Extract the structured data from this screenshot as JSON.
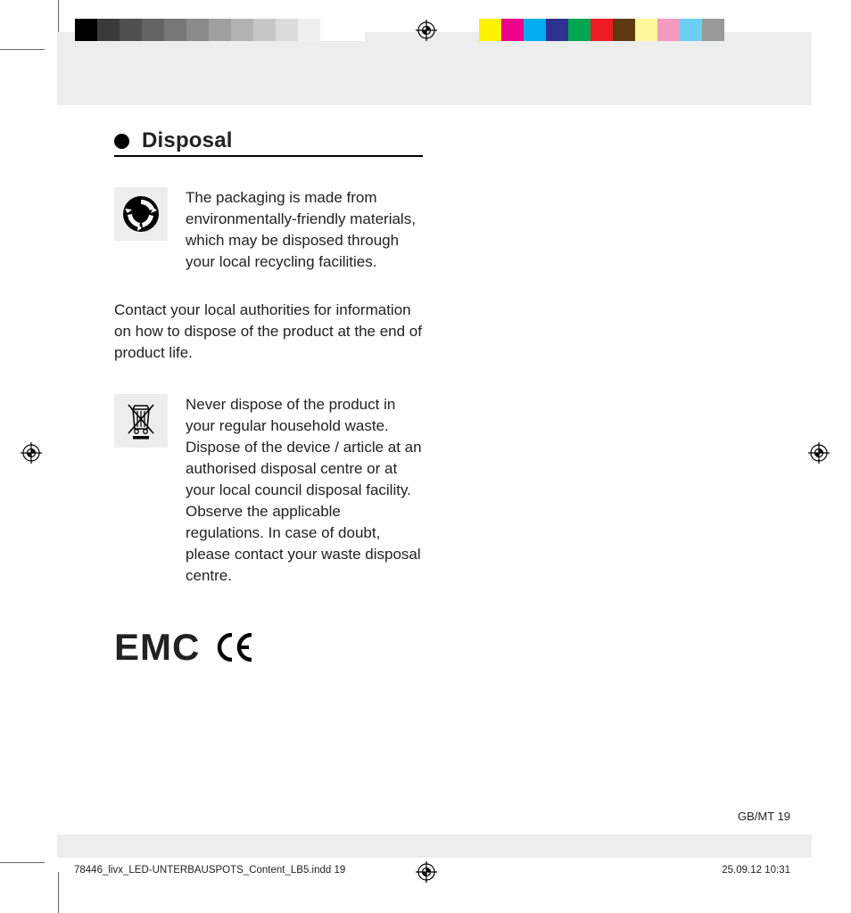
{
  "heading": "Disposal",
  "block1_text": "The packaging is made from environmentally-friendly materials, which may be disposed through your local recycling facilities.",
  "para1": "Contact your local authorities for information on how to dispose of the product at the end of product life.",
  "block2_text": "Never dispose of the product in your regular household waste. Dispose of the device / article at an authorised disposal centre or at your local council disposal facility. Observe the applicable regulations. In case of doubt, please contact your waste disposal centre.",
  "emc_label": "EMC",
  "page_label": "GB/MT   19",
  "footer_file": "78446_livx_LED-UNTERBAUSPOTS_Content_LB5.indd   19",
  "footer_datetime": "25.09.12   10:31",
  "colorbar_left": [
    "#000000",
    "#3a3a3a",
    "#4f4f4f",
    "#636363",
    "#777777",
    "#8b8b8b",
    "#9f9f9f",
    "#b3b3b3",
    "#c7c7c7",
    "#dbdbdb",
    "#efefef",
    "#ffffff",
    "#ffffff"
  ],
  "colorbar_right": [
    "#fff200",
    "#ec008c",
    "#00aeef",
    "#2e3192",
    "#00a651",
    "#ed1c24",
    "#603913",
    "#fff799",
    "#f49ac1",
    "#6dcff6",
    "#999999"
  ]
}
